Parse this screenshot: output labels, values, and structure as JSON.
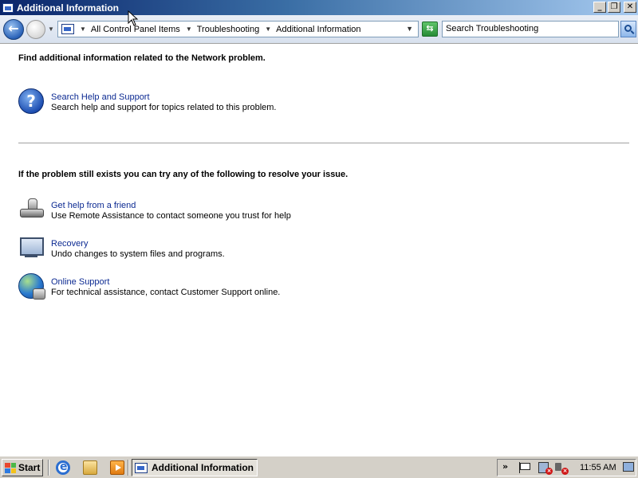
{
  "window": {
    "title": "Additional Information",
    "buttons": {
      "minimize": "_",
      "maximize": "❐",
      "close": "✕"
    }
  },
  "nav": {
    "back_glyph": "←",
    "breadcrumbs": [
      "All Control Panel Items",
      "Troubleshooting",
      "Additional Information"
    ],
    "refresh_glyph": "⇆",
    "search_placeholder": "Search Troubleshooting"
  },
  "main": {
    "section1_heading": "Find additional information related to the Network problem.",
    "section1_items": [
      {
        "icon": "help-icon",
        "title": "Search Help and Support",
        "description": "Search help and support for topics related to this problem."
      }
    ],
    "section2_heading": "If the problem still exists you can try any of the following to resolve your issue.",
    "section2_items": [
      {
        "icon": "friend-icon",
        "title": "Get help from a friend",
        "description": "Use Remote Assistance to contact someone you trust for help"
      },
      {
        "icon": "recovery-icon",
        "title": "Recovery",
        "description": "Undo changes to system files and programs."
      },
      {
        "icon": "globe-icon",
        "title": "Online Support",
        "description": "For technical assistance, contact Customer Support online."
      }
    ]
  },
  "taskbar": {
    "start_label": "Start",
    "task_label": "Additional Information",
    "clock": "11:55 AM",
    "tray_chevron": "»"
  },
  "colors": {
    "link": "#0c2a92",
    "titlebar_start": "#0a246a",
    "titlebar_end": "#a6caf0",
    "taskbar": "#d4d0c8"
  }
}
